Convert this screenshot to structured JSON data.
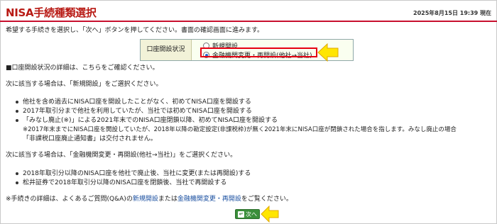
{
  "header": {
    "title": "NISA手続種類選択",
    "datetime": "2025年8月15日 19:39 現在"
  },
  "intro": "希望する手続きを選択し、「次へ」ボタンを押してください。書面の確認画面に進みます。",
  "selection": {
    "label": "口座開設状況",
    "options": [
      {
        "label": "新規開設",
        "selected": false
      },
      {
        "label": "金融機関変更・再開設(他社→当社)",
        "selected": true
      }
    ]
  },
  "status_note": "■口座開設状況の詳細は、こちらをご確認ください。",
  "new_section": {
    "heading": "次に該当する場合は、「新規開設」をご選択ください。",
    "items": [
      "他社を含め過去にNISA口座を開設したことがなく、初めてNISA口座を開設する",
      "2017年取引分まで他社を利用していたが、当社では初めてNISA口座を開設する",
      "「みなし廃止(※)」による2021年末でのNISA口座閉鎖以降、初めてNISA口座を開設する"
    ],
    "note_line1": "※2017年末までにNISA口座を開設していたが、2018年以降の勘定設定(非課税枠)が無く2021年末にNISA口座が閉鎖された場合を指します。みなし廃止の場合",
    "note_line2": "「非課税口座廃止通知書」は交付されません。"
  },
  "transfer_section": {
    "heading": "次に該当する場合は、「金融機関変更・再開設(他社→当社)」をご選択ください。",
    "items": [
      "2018年取引分以降のNISA口座を他社で廃止後、当社に変更(または再開設)する",
      "松井証券で2018年取引分以降のNISA口座を閉鎖後、当社で再開設する"
    ]
  },
  "footer_note": {
    "prefix": "※手続きの詳細は、よくあるご質問(Q&A)の",
    "link1": "新規開設",
    "middle": "または",
    "link2": "金融機関変更・再開設",
    "suffix": "をご覧ください。"
  },
  "next_button": {
    "label": "次へ"
  },
  "colors": {
    "title": "#b81a14",
    "accent_line": "#c8102e",
    "highlight_box": "#e60012",
    "callout_arrow": "#ffe600",
    "button": "#3a8f3a",
    "link": "#1a4fa0"
  },
  "icons": [
    "radio-button",
    "callout-arrow-icon",
    "next-arrow-icon"
  ]
}
